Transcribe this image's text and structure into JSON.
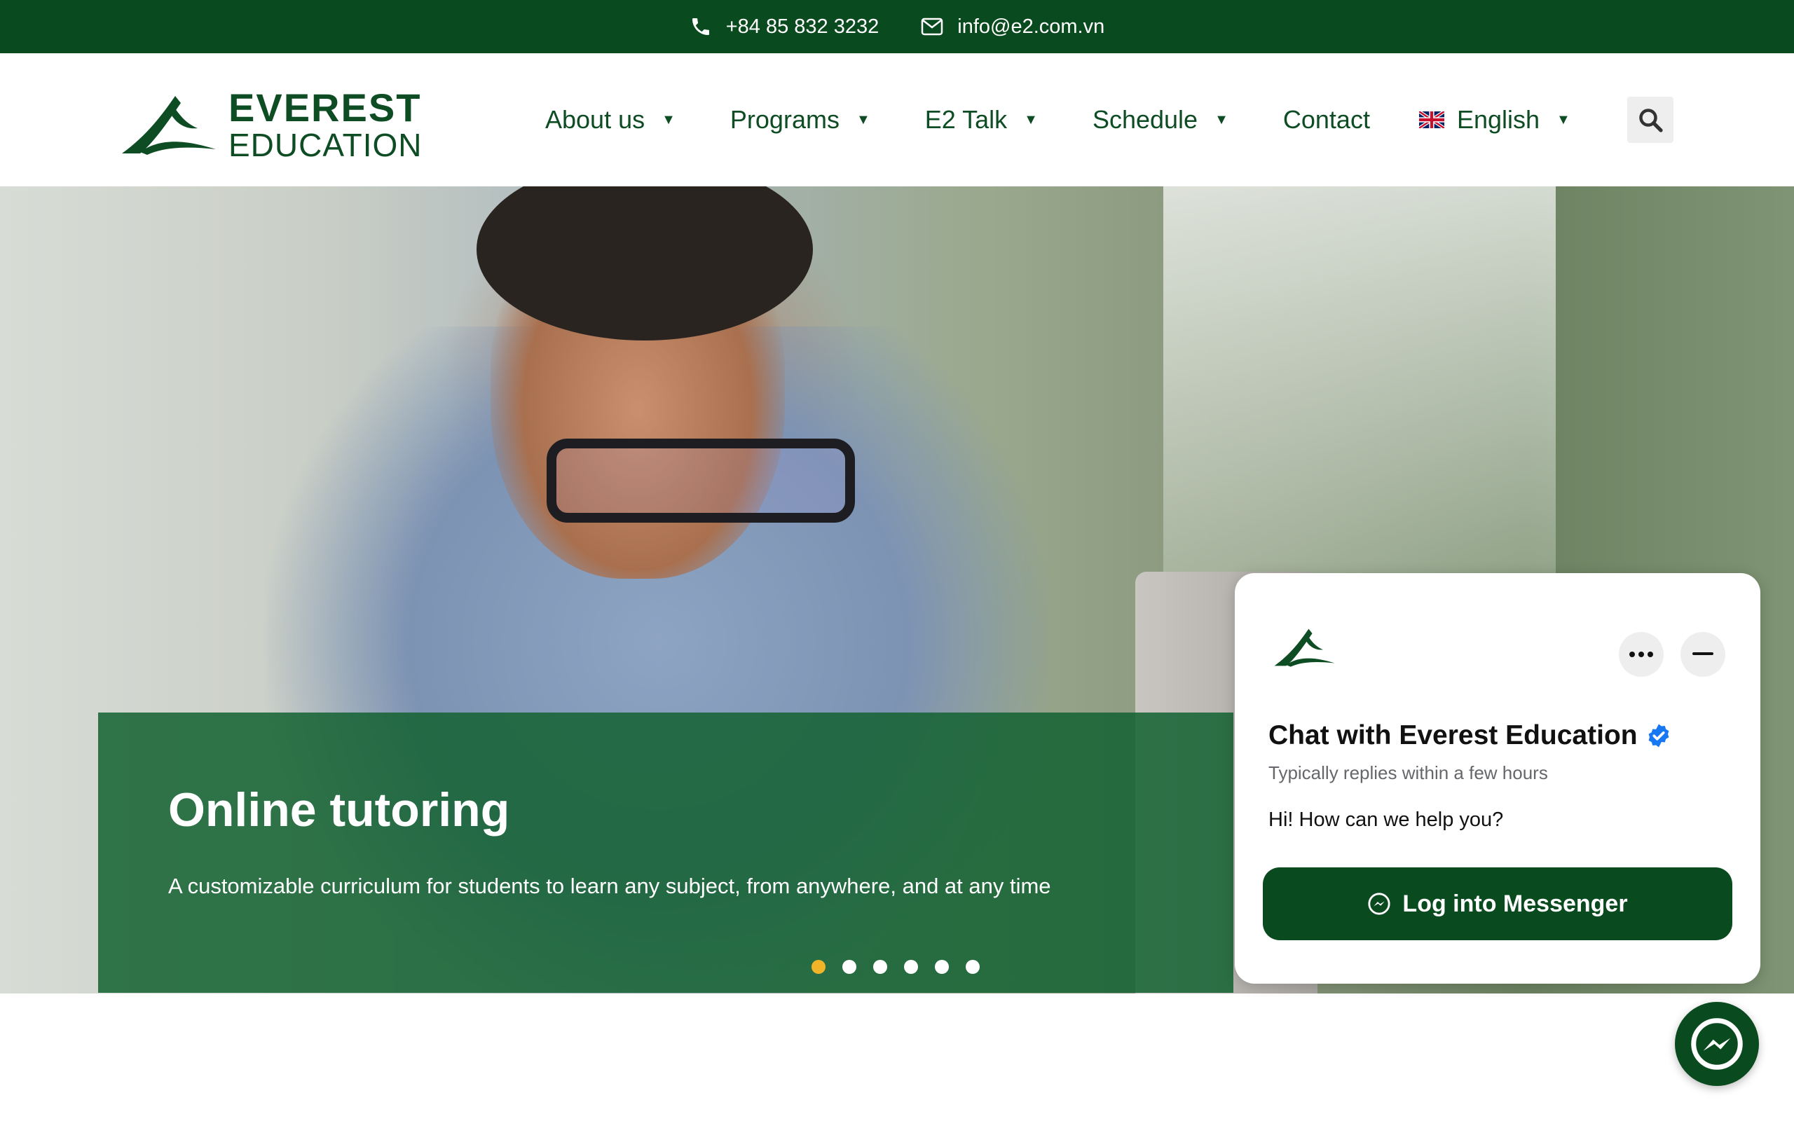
{
  "topbar": {
    "phone": "+84 85 832 3232",
    "email": "info@e2.com.vn",
    "phone_icon": "phone-icon",
    "email_icon": "envelope-icon"
  },
  "brand": {
    "line1": "EVEREST",
    "line2": "EDUCATION",
    "color": "#0a4a1f"
  },
  "nav": {
    "about": "About us",
    "programs": "Programs",
    "e2talk": "E2 Talk",
    "schedule": "Schedule",
    "contact": "Contact",
    "language": "English",
    "language_icon": "uk-flag-icon",
    "search_icon": "search-icon"
  },
  "hero": {
    "title": "Online tutoring",
    "subtitle": "A customizable curriculum for students to learn any subject, from anywhere, and at any time",
    "slide_count": 6,
    "active_slide": 1,
    "active_dot_color": "#f0b429"
  },
  "chat": {
    "title": "Chat with Everest Education",
    "status": "Typically replies within a few hours",
    "message": "Hi! How can we help you?",
    "login_label": "Log into Messenger",
    "verified_icon": "verified-badge-icon",
    "more_icon": "more-options-icon",
    "minimize_icon": "minimize-icon"
  },
  "fab_icon": "messenger-icon"
}
